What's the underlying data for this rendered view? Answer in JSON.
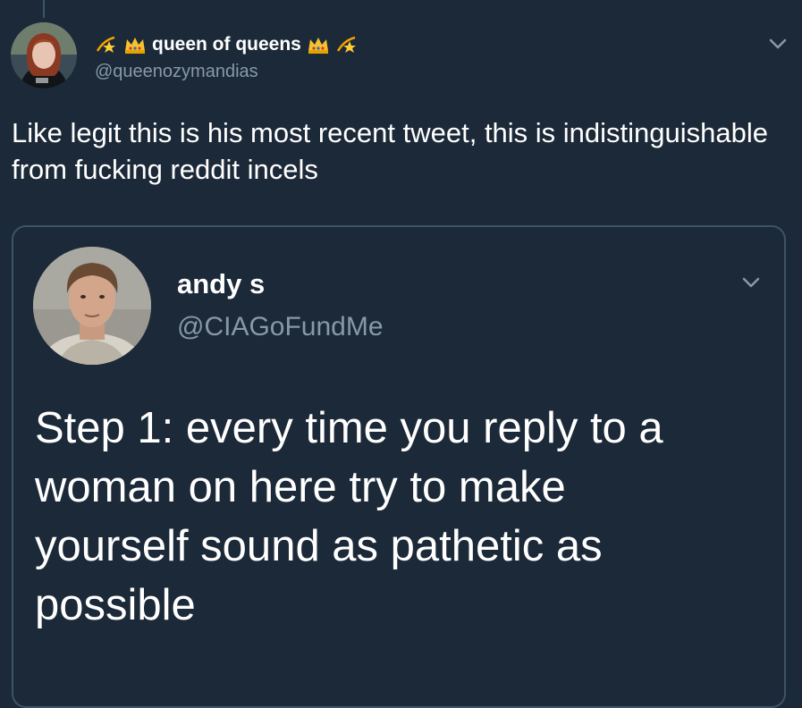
{
  "tweet": {
    "display_name": "queen of queens",
    "handle": "@queenozymandias",
    "text": "Like legit this is his most recent tweet, this is indistinguishable from fucking reddit incels",
    "name_emojis": [
      "star-icon",
      "crown-icon",
      "crown-icon",
      "star-icon"
    ]
  },
  "quoted_tweet": {
    "display_name": "andy s",
    "handle": "@CIAGoFundMe",
    "text": "Step 1: every time you reply to a woman on here try to make yourself sound as pathetic as possible"
  },
  "colors": {
    "background": "#1c2938",
    "text": "#ffffff",
    "secondary_text": "#8899a6",
    "border": "#3d5466"
  }
}
